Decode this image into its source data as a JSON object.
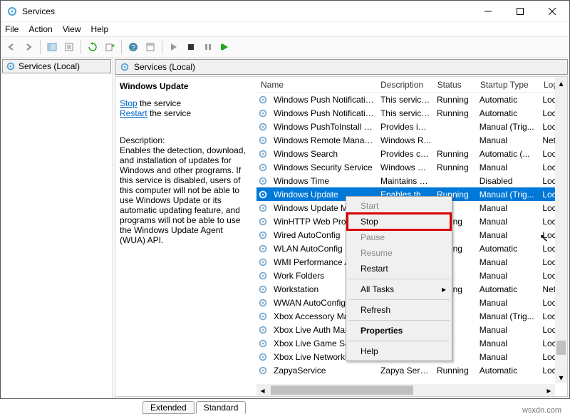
{
  "window": {
    "title": "Services",
    "min_icon": "minimize-icon",
    "max_icon": "maximize-icon",
    "close_icon": "close-icon"
  },
  "menubar": {
    "file": "File",
    "action": "Action",
    "view": "View",
    "help": "Help"
  },
  "leftnav": {
    "item": "Services (Local)"
  },
  "pane": {
    "header": "Services (Local)"
  },
  "detail": {
    "selected_name": "Windows Update",
    "stop_label": "Stop",
    "stop_suffix": " the service",
    "restart_label": "Restart",
    "restart_suffix": " the service",
    "desc_label": "Description:",
    "desc_text": "Enables the detection, download, and installation of updates for Windows and other programs. If this service is disabled, users of this computer will not be able to use Windows Update or its automatic updating feature, and programs will not be able to use the Windows Update Agent (WUA) API."
  },
  "columns": {
    "name": "Name",
    "desc": "Description",
    "status": "Status",
    "startup": "Startup Type",
    "logon": "Log"
  },
  "rows": [
    {
      "name": "Windows Push Notification...",
      "desc": "This service ...",
      "status": "Running",
      "startup": "Automatic",
      "logon": "Loca"
    },
    {
      "name": "Windows Push Notification...",
      "desc": "This service ...",
      "status": "Running",
      "startup": "Automatic",
      "logon": "Loca"
    },
    {
      "name": "Windows PushToInstall Serv...",
      "desc": "Provides inf...",
      "status": "",
      "startup": "Manual (Trig...",
      "logon": "Loca"
    },
    {
      "name": "Windows Remote Manage...",
      "desc": "Windows R...",
      "status": "",
      "startup": "Manual",
      "logon": "Net"
    },
    {
      "name": "Windows Search",
      "desc": "Provides co...",
      "status": "Running",
      "startup": "Automatic (...",
      "logon": "Loca"
    },
    {
      "name": "Windows Security Service",
      "desc": "Windows Se...",
      "status": "Running",
      "startup": "Manual",
      "logon": "Loca"
    },
    {
      "name": "Windows Time",
      "desc": "Maintains d...",
      "status": "",
      "startup": "Disabled",
      "logon": "Loca"
    },
    {
      "name": "Windows Update",
      "desc": "Enables the...",
      "status": "Running",
      "startup": "Manual (Trig...",
      "logon": "Loca",
      "selected": true
    },
    {
      "name": "Windows Update Me",
      "desc": "",
      "status": "",
      "startup": "Manual",
      "logon": "Loca"
    },
    {
      "name": "WinHTTP Web Proxy",
      "desc": "",
      "status": "unning",
      "startup": "Manual",
      "logon": "Loca"
    },
    {
      "name": "Wired AutoConfig",
      "desc": "",
      "status": "",
      "startup": "Manual",
      "logon": "Loca"
    },
    {
      "name": "WLAN AutoConfig",
      "desc": "",
      "status": "unning",
      "startup": "Automatic",
      "logon": "Loca"
    },
    {
      "name": "WMI Performance A",
      "desc": "",
      "status": "",
      "startup": "Manual",
      "logon": "Loca"
    },
    {
      "name": "Work Folders",
      "desc": "",
      "status": "",
      "startup": "Manual",
      "logon": "Loca"
    },
    {
      "name": "Workstation",
      "desc": "",
      "status": "unning",
      "startup": "Automatic",
      "logon": "Net"
    },
    {
      "name": "WWAN AutoConfig",
      "desc": "",
      "status": "",
      "startup": "Manual",
      "logon": "Loca"
    },
    {
      "name": "Xbox Accessory Mar",
      "desc": "",
      "status": "",
      "startup": "Manual (Trig...",
      "logon": "Loca"
    },
    {
      "name": "Xbox Live Auth Man",
      "desc": "",
      "status": "",
      "startup": "Manual",
      "logon": "Loca"
    },
    {
      "name": "Xbox Live Game Sav",
      "desc": "",
      "status": "",
      "startup": "Manual",
      "logon": "Loca"
    },
    {
      "name": "Xbox Live Networkin",
      "desc": "",
      "status": "",
      "startup": "Manual",
      "logon": "Loca"
    },
    {
      "name": "ZapyaService",
      "desc": "Zapya Service",
      "status": "Running",
      "startup": "Automatic",
      "logon": "Loca"
    }
  ],
  "context_menu": {
    "start": "Start",
    "stop": "Stop",
    "pause": "Pause",
    "resume": "Resume",
    "restart": "Restart",
    "all_tasks": "All Tasks",
    "refresh": "Refresh",
    "properties": "Properties",
    "help": "Help"
  },
  "tabs": {
    "extended": "Extended",
    "standard": "Standard"
  },
  "watermark": "wsxdn.com"
}
